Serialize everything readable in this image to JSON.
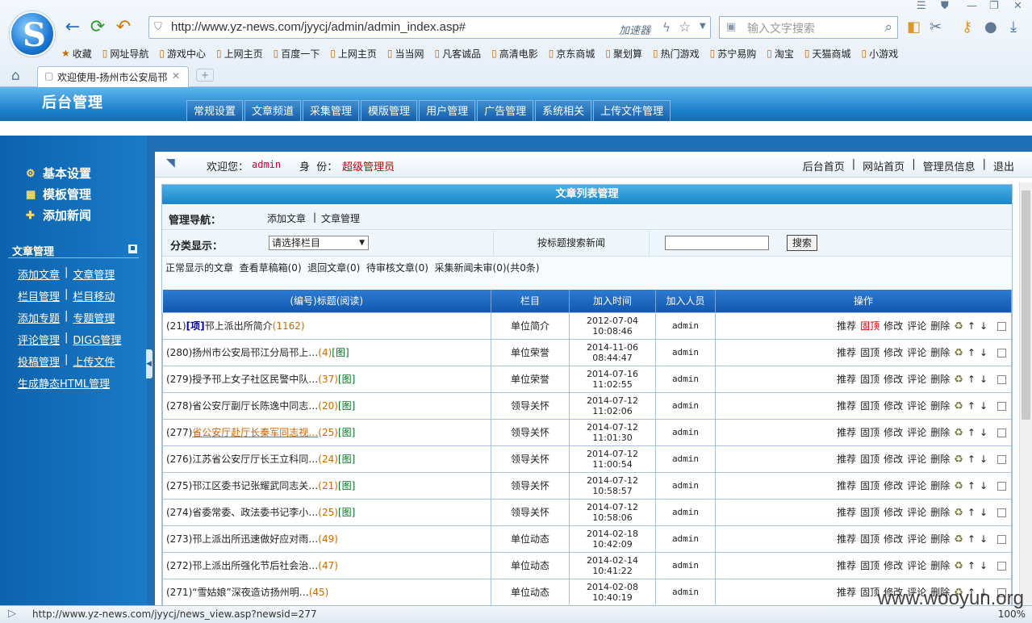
{
  "browser": {
    "url": "http://www.yz-news.com/jyycj/admin/admin_index.asp#",
    "accelerator": "加速器",
    "search_placeholder": "输入文字搜索",
    "tab_title": "欢迎使用-扬州市公安局邗",
    "favorites": [
      "收藏",
      "网址导航",
      "游戏中心",
      "上网主页",
      "百度一下",
      "上网主页",
      "当当网",
      "凡客诚品",
      "高清电影",
      "京东商城",
      "聚划算",
      "热门游戏",
      "苏宁易购",
      "淘宝",
      "天猫商城",
      "小游戏"
    ],
    "status_url": "http://www.yz-news.com/jyycj/news_view.asp?newsid=277",
    "zoom": "100%",
    "watermark": "www.wooyun.org"
  },
  "admin": {
    "title": "后台管理",
    "topnav": [
      "常规设置",
      "文章频道",
      "采集管理",
      "模版管理",
      "用户管理",
      "广告管理",
      "系统相关",
      "上传文件管理"
    ]
  },
  "sidebar": {
    "main_items": [
      "基本设置",
      "模板管理",
      "添加新闻"
    ],
    "section_title": "文章管理",
    "links": [
      [
        "添加文章",
        "文章管理"
      ],
      [
        "栏目管理",
        "栏目移动"
      ],
      [
        "添加专题",
        "专题管理"
      ],
      [
        "评论管理",
        "DIGG管理"
      ],
      [
        "投稿管理",
        "上传文件"
      ],
      [
        "生成静态HTML管理"
      ]
    ],
    "sep": "|"
  },
  "welcome": {
    "label": "欢迎您：",
    "user": "admin",
    "role_label": "身  份：",
    "role": "超级管理员",
    "links": [
      "后台首页",
      "网站首页",
      "管理员信息",
      "退出"
    ]
  },
  "panel": {
    "title": "文章列表管理",
    "nav_label": "管理导航：",
    "nav_links": [
      "添加文章",
      "文章管理"
    ],
    "cat_label": "分类显示：",
    "cat_select": "请选择栏目",
    "search_label": "按标题搜索新闻",
    "search_btn": "搜索",
    "filters": "正常显示的文章  查看草稿箱(0)  退回文章(0)  待审核文章(0)  采集新闻未审(0)(共0条)"
  },
  "table": {
    "headers": [
      "(编号)标题(阅读)",
      "栏目",
      "加入时间",
      "加入人员",
      "操作"
    ],
    "ops": [
      "推荐",
      "固顶",
      "修改",
      "评论",
      "删除"
    ],
    "rows": [
      {
        "id": "(21)",
        "tag": "[项]",
        "title": "邗上派出所简介",
        "count": "(1162)",
        "img": "",
        "cat": "单位简介",
        "date": "2012-07-04",
        "time": "10:08:46",
        "user": "admin",
        "pinned": true
      },
      {
        "id": "(280)",
        "tag": "",
        "title": "扬州市公安局邗江分局邗上…",
        "count": "(4)",
        "img": "[图]",
        "cat": "单位荣誉",
        "date": "2014-11-06",
        "time": "08:44:47",
        "user": "admin",
        "pinned": false
      },
      {
        "id": "(279)",
        "tag": "",
        "title": "授予邗上女子社区民警中队…",
        "count": "(37)",
        "img": "[图]",
        "cat": "单位荣誉",
        "date": "2014-07-16",
        "time": "11:02:55",
        "user": "admin",
        "pinned": false
      },
      {
        "id": "(278)",
        "tag": "",
        "title": "省公安厅副厅长陈逸中同志…",
        "count": "(20)",
        "img": "[图]",
        "cat": "领导关怀",
        "date": "2014-07-12",
        "time": "11:02:06",
        "user": "admin",
        "pinned": false
      },
      {
        "id": "(277)",
        "tag": "",
        "title": "省公安厅赴厅长秦军同志视…",
        "count": "(25)",
        "img": "[图]",
        "cat": "领导关怀",
        "date": "2014-07-12",
        "time": "11:01:30",
        "user": "admin",
        "pinned": false,
        "hover": true
      },
      {
        "id": "(276)",
        "tag": "",
        "title": "江苏省公安厅厅长王立科同…",
        "count": "(24)",
        "img": "[图]",
        "cat": "领导关怀",
        "date": "2014-07-12",
        "time": "11:00:54",
        "user": "admin",
        "pinned": false
      },
      {
        "id": "(275)",
        "tag": "",
        "title": "邗江区委书记张耀武同志关…",
        "count": "(21)",
        "img": "[图]",
        "cat": "领导关怀",
        "date": "2014-07-12",
        "time": "10:58:57",
        "user": "admin",
        "pinned": false
      },
      {
        "id": "(274)",
        "tag": "",
        "title": "省委常委、政法委书记李小…",
        "count": "(25)",
        "img": "[图]",
        "cat": "领导关怀",
        "date": "2014-07-12",
        "time": "10:58:06",
        "user": "admin",
        "pinned": false
      },
      {
        "id": "(273)",
        "tag": "",
        "title": "邗上派出所迅速做好应对雨…",
        "count": "(49)",
        "img": "",
        "cat": "单位动态",
        "date": "2014-02-18",
        "time": "10:42:09",
        "user": "admin",
        "pinned": false
      },
      {
        "id": "(272)",
        "tag": "",
        "title": "邗上派出所强化节后社会治…",
        "count": "(47)",
        "img": "",
        "cat": "单位动态",
        "date": "2014-02-14",
        "time": "10:41:22",
        "user": "admin",
        "pinned": false
      },
      {
        "id": "(271)",
        "tag": "",
        "title": "“雪姑娘”深夜造访扬州明…",
        "count": "(45)",
        "img": "",
        "cat": "单位动态",
        "date": "2014-02-08",
        "time": "10:40:19",
        "user": "admin",
        "pinned": false
      }
    ]
  }
}
